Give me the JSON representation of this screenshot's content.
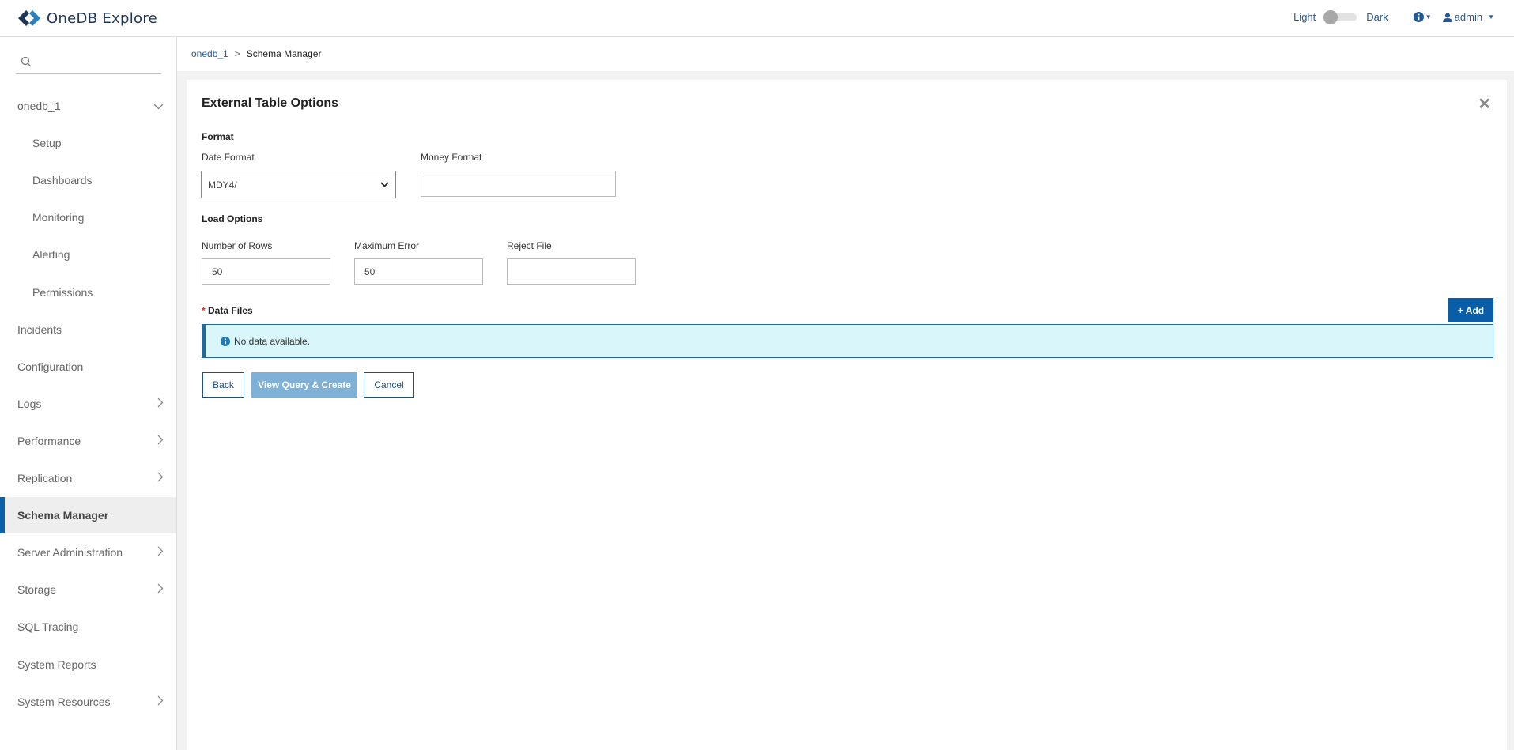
{
  "header": {
    "app_name": "OneDB Explore",
    "theme_light": "Light",
    "theme_dark": "Dark",
    "user": "admin"
  },
  "sidebar": {
    "search_placeholder": "",
    "items": [
      {
        "label": "onedb_1",
        "sub": false,
        "chevron": "down"
      },
      {
        "label": "Setup",
        "sub": true
      },
      {
        "label": "Dashboards",
        "sub": true
      },
      {
        "label": "Monitoring",
        "sub": true
      },
      {
        "label": "Alerting",
        "sub": true
      },
      {
        "label": "Permissions",
        "sub": true
      },
      {
        "label": "Incidents"
      },
      {
        "label": "Configuration"
      },
      {
        "label": "Logs",
        "chevron": "right"
      },
      {
        "label": "Performance",
        "chevron": "right"
      },
      {
        "label": "Replication",
        "chevron": "right"
      },
      {
        "label": "Schema Manager",
        "active": true
      },
      {
        "label": "Server Administration",
        "chevron": "right"
      },
      {
        "label": "Storage",
        "chevron": "right"
      },
      {
        "label": "SQL Tracing"
      },
      {
        "label": "System Reports"
      },
      {
        "label": "System Resources",
        "chevron": "right"
      }
    ]
  },
  "breadcrumb": {
    "root": "onedb_1",
    "sep": ">",
    "current": "Schema Manager"
  },
  "panel": {
    "title": "External Table Options",
    "format_section": "Format",
    "date_format_label": "Date Format",
    "date_format_value": "MDY4/",
    "money_format_label": "Money Format",
    "money_format_value": "",
    "load_section": "Load Options",
    "rows_label": "Number of Rows",
    "rows_value": "50",
    "max_error_label": "Maximum Error",
    "max_error_value": "50",
    "reject_label": "Reject File",
    "reject_value": "",
    "data_files_required": "*",
    "data_files_label": "Data Files",
    "add_label": "+ Add",
    "no_data": "No data available.",
    "back_label": "Back",
    "view_label": "View Query & Create",
    "cancel_label": "Cancel"
  }
}
